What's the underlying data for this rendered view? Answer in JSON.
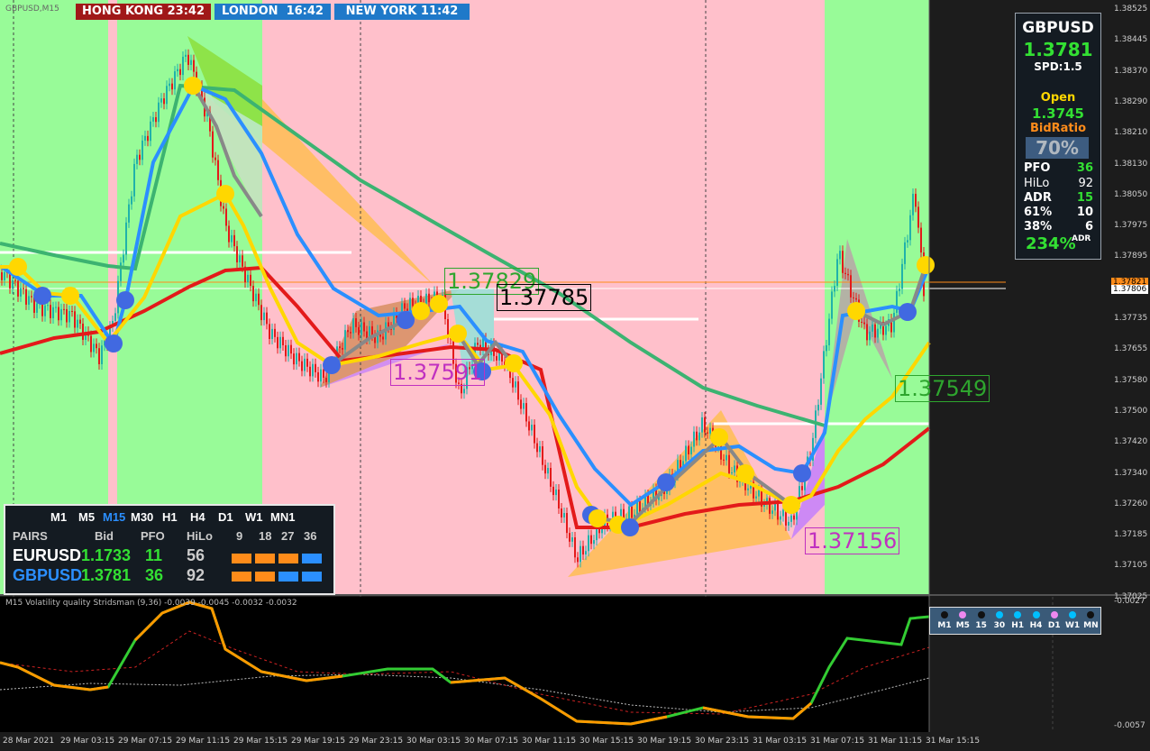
{
  "symbol_tf": "GBPUSD,M15",
  "sessions": [
    {
      "city": "HONG KONG",
      "time": "23:42",
      "color": "#a01818"
    },
    {
      "city": "LONDON",
      "time": "16:42",
      "color": "#1f79c9"
    },
    {
      "city": "NEW YORK",
      "time": "11:42",
      "color": "#1f79c9"
    }
  ],
  "price_axis": [
    "1.38525",
    "1.38445",
    "1.38370",
    "1.38290",
    "1.38210",
    "1.38130",
    "1.38050",
    "1.37975",
    "1.37895",
    "1.37815",
    "1.37735",
    "1.37655",
    "1.37580",
    "1.37500",
    "1.37420",
    "1.37340",
    "1.37260",
    "1.37185",
    "1.37105",
    "1.37025"
  ],
  "current_price_tags": [
    "1.37821",
    "1.37806"
  ],
  "time_axis": [
    "28 Mar 2021",
    "29 Mar 03:15",
    "29 Mar 07:15",
    "29 Mar 11:15",
    "29 Mar 15:15",
    "29 Mar 19:15",
    "29 Mar 23:15",
    "30 Mar 03:15",
    "30 Mar 07:15",
    "30 Mar 11:15",
    "30 Mar 15:15",
    "30 Mar 19:15",
    "30 Mar 23:15",
    "31 Mar 03:15",
    "31 Mar 07:15",
    "31 Mar 11:15",
    "31 Mar 15:15"
  ],
  "chart_labels": [
    {
      "text": "1.37829",
      "color": "#2ea52e",
      "border": "#2ea52e"
    },
    {
      "text": "1.37785",
      "color": "#000000",
      "border": "#000000"
    },
    {
      "text": "1.37591",
      "color": "#c030c0",
      "border": "#c030c0"
    },
    {
      "text": "1.37549",
      "color": "#2ea52e",
      "border": "#2ea52e"
    },
    {
      "text": "1.37156",
      "color": "#c030c0",
      "border": "#c030c0"
    }
  ],
  "info_panel": {
    "symbol": "GBPUSD",
    "price": "1.3781",
    "spread": "SPD:1.5",
    "open_label": "Open",
    "open_value": "1.3745",
    "bidratio_label": "BidRatio",
    "bidratio_value": "70%",
    "stats": [
      {
        "k": "PFO",
        "v": "36",
        "vcolor": "#33e033"
      },
      {
        "k": "HiLo",
        "v": "92",
        "vcolor": "#ffffff"
      },
      {
        "k": "ADR",
        "v": "15",
        "vcolor": "#33e033"
      },
      {
        "k": "61%",
        "v": "10",
        "vcolor": "#ffffff"
      },
      {
        "k": "38%",
        "v": "6",
        "vcolor": "#ffffff"
      }
    ],
    "adr_pct": "234%",
    "adr_suffix": "ADR"
  },
  "pairs_panel": {
    "timeframes": [
      "M1",
      "M5",
      "M15",
      "M30",
      "H1",
      "H4",
      "D1",
      "W1",
      "MN1"
    ],
    "active_tf": "M15",
    "headers": [
      "PAIRS",
      "Bid",
      "PFO",
      "HiLo",
      "9",
      "18",
      "27",
      "36"
    ],
    "rows": [
      {
        "pair": "EURUSD",
        "bid": "1.1733",
        "pfo": "11",
        "hilo": "56",
        "pair_color": "#ffffff",
        "bars": [
          "#ff8c1a",
          "#ff8c1a",
          "#ff8c1a",
          "#2b8fff"
        ]
      },
      {
        "pair": "GBPUSD",
        "bid": "1.3781",
        "pfo": "36",
        "hilo": "92",
        "pair_color": "#2b8fff",
        "bars": [
          "#ff8c1a",
          "#ff8c1a",
          "#2b8fff",
          "#2b8fff"
        ]
      }
    ]
  },
  "indicator": {
    "title": "M15 Volatility quality Stridsman (9,36) -0.0039 -0.0045 -0.0032 -0.0032",
    "scale_top": "-0.0027",
    "scale_bottom": "-0.0057"
  },
  "tf_panel": {
    "labels": [
      "M1",
      "M5",
      "15",
      "30",
      "H1",
      "H4",
      "D1",
      "W1",
      "MN"
    ],
    "dots": [
      "#111111",
      "#ee88ee",
      "#111111",
      "#00bfff",
      "#00bfff",
      "#00bfff",
      "#ee88ee",
      "#00bfff",
      "#111111"
    ]
  }
}
